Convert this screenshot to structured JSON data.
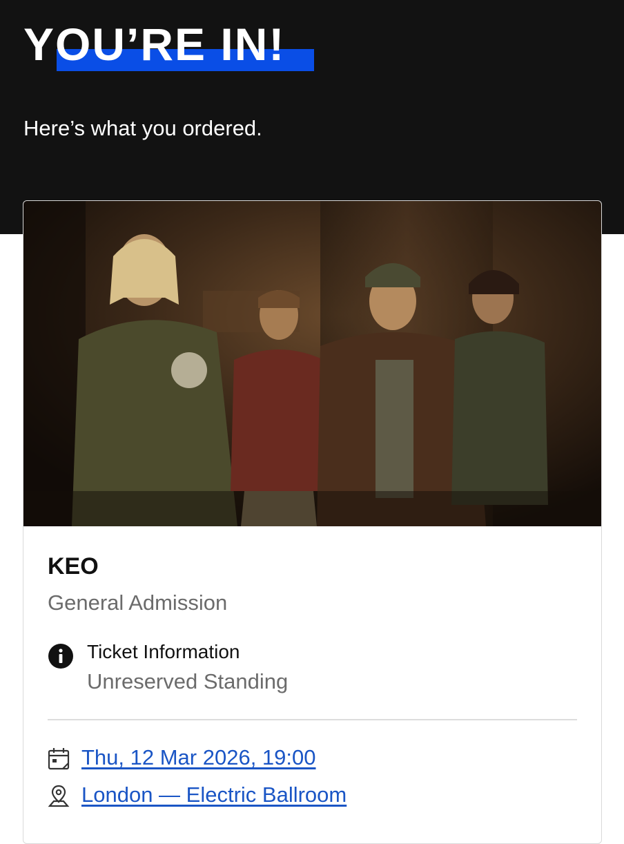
{
  "header": {
    "title": "YOU’RE IN!",
    "subtitle": "Here’s what you ordered.",
    "accent_color": "#0a4ee6",
    "background_color": "#121212"
  },
  "order_card": {
    "image_icon": "band-photo",
    "event_name": "KEO",
    "ticket_type": "General Admission",
    "ticket_info": {
      "icon": "info-icon",
      "label": "Ticket Information",
      "value": "Unreserved Standing"
    },
    "date": {
      "icon": "calendar-icon",
      "text": "Thu, 12 Mar 2026, 19:00"
    },
    "venue": {
      "icon": "location-pin-icon",
      "text": "London — Electric Ballroom"
    },
    "link_color": "#1a55c5"
  }
}
